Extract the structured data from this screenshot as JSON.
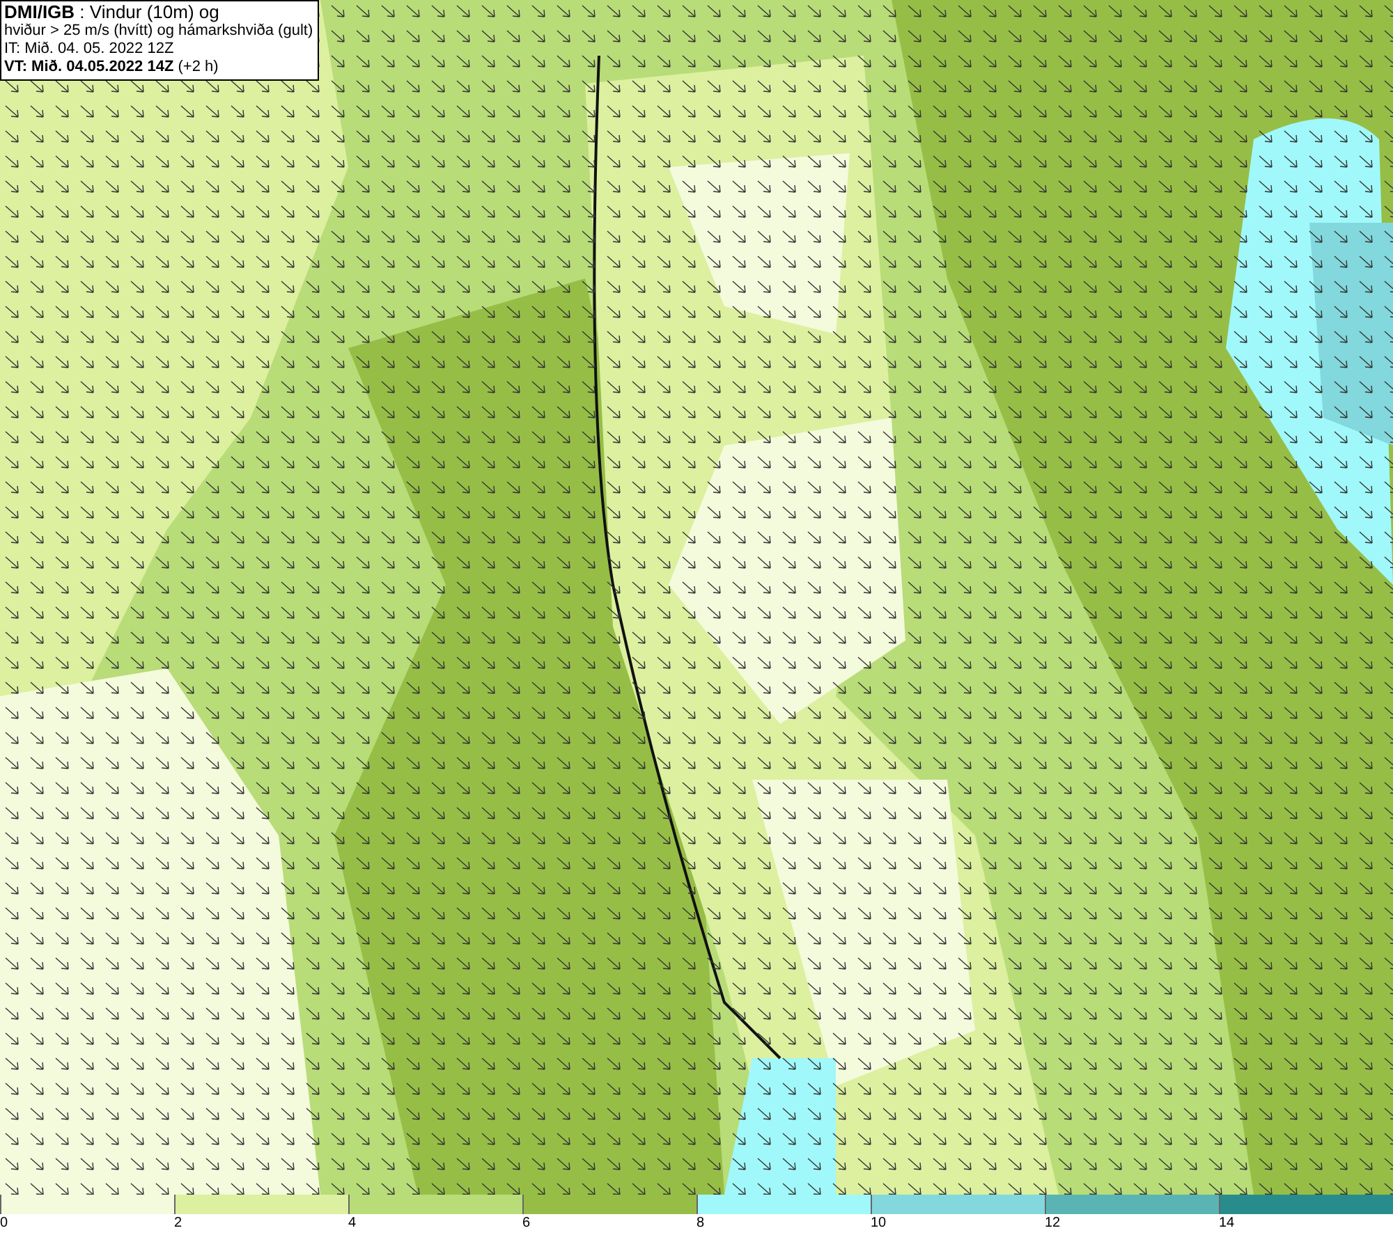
{
  "header": {
    "lines": [
      "**DMI/IGB** : Vindur (10m) og",
      "hviður > 25 m/s (hvítt) og hámarkshviða (gult)",
      "IT: Mið. 04. 05. 2022 12Z",
      "**VT: Mið. 04.05.2022 14Z** (+2 h)"
    ]
  },
  "legend": [
    {
      "label": "0",
      "color": "#f4fadc"
    },
    {
      "label": "2",
      "color": "#dcf0a0"
    },
    {
      "label": "4",
      "color": "#b8dc78"
    },
    {
      "label": "6",
      "color": "#96be46"
    },
    {
      "label": "8",
      "color": "#a0f8fa"
    },
    {
      "label": "10",
      "color": "#82d8dc"
    },
    {
      "label": "12",
      "color": "#5ab4b4"
    },
    {
      "label": "14",
      "color": "#288c8c"
    }
  ]
}
